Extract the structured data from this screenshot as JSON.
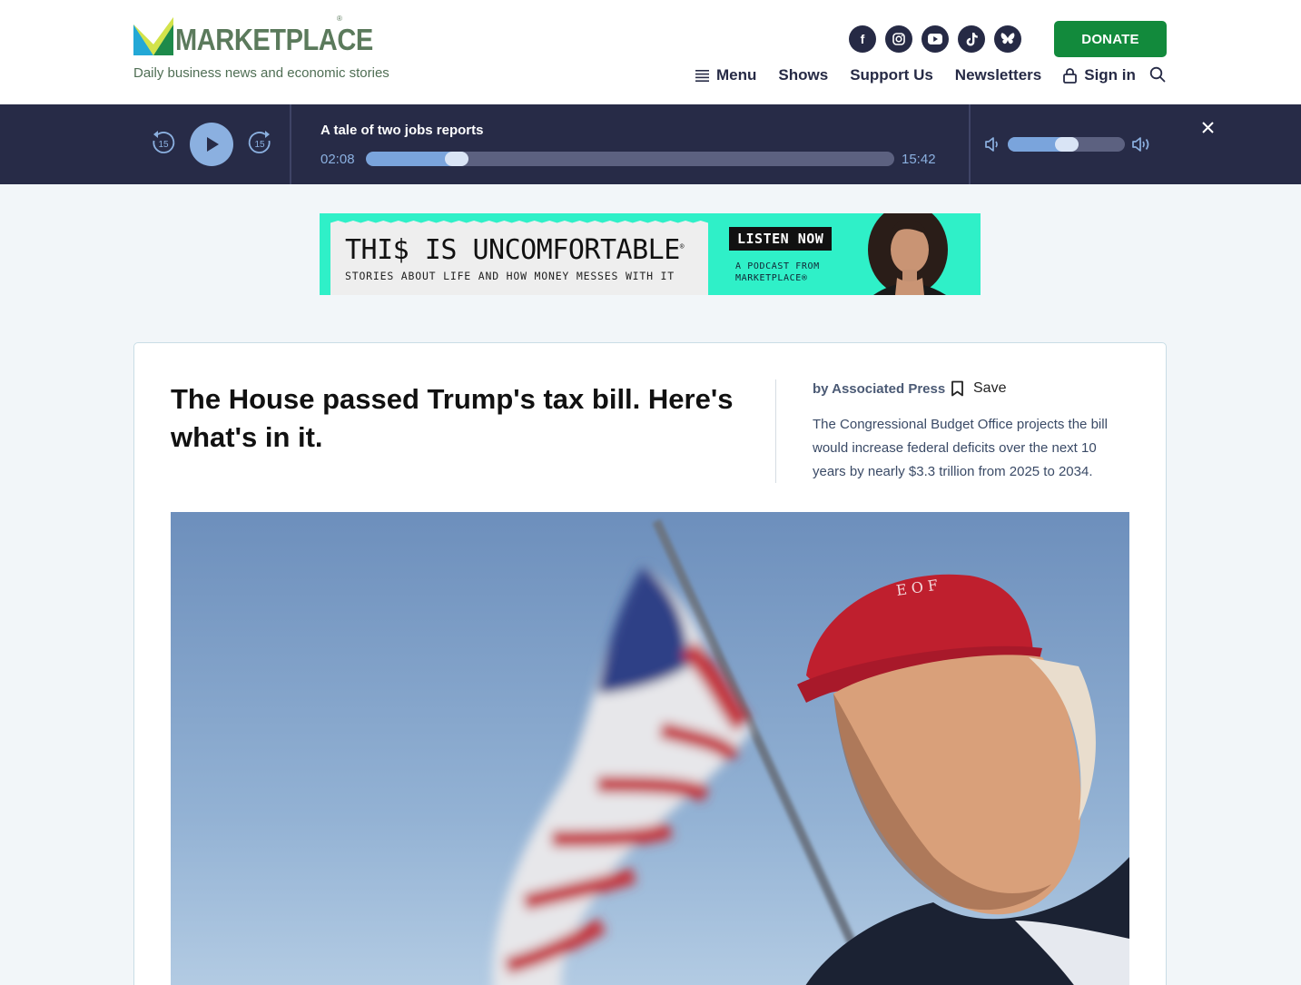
{
  "header": {
    "logo_text": "MARKETPLACE",
    "logo_reg": "®",
    "tagline": "Daily business news and economic stories",
    "socials": [
      {
        "name": "facebook",
        "glyph": "f"
      },
      {
        "name": "instagram",
        "glyph": "◎"
      },
      {
        "name": "youtube",
        "glyph": "▶"
      },
      {
        "name": "tiktok",
        "glyph": "♪"
      },
      {
        "name": "bluesky",
        "glyph": "🦋"
      }
    ],
    "donate_label": "DONATE",
    "nav": {
      "menu": "Menu",
      "shows": "Shows",
      "support": "Support Us",
      "newsletters": "Newsletters",
      "signin": "Sign in"
    },
    "icons": [
      "hamburger-icon",
      "lock-icon",
      "search-icon"
    ]
  },
  "player": {
    "episode_title": "A tale of two jobs reports",
    "elapsed": "02:08",
    "duration": "15:42",
    "progress": 0.15,
    "volume": 0.5,
    "skip_back_seconds": "15",
    "skip_forward_seconds": "15",
    "colors": {
      "bg": "#272b47",
      "accent": "#8bb0e0"
    }
  },
  "ad": {
    "title": "THI$ IS UNCOMFORTABLE",
    "title_reg": "®",
    "subtitle": "STORIES ABOUT LIFE AND HOW MONEY MESSES WITH IT",
    "cta": "LISTEN NOW",
    "podcast_line1": "A PODCAST FROM",
    "podcast_line2": "MARKETPLACE®",
    "bg_color": "#2ff0c8"
  },
  "article": {
    "headline": "The House passed Trump's tax bill. Here's what's in it.",
    "byline": "by Associated Press",
    "save_label": "Save",
    "dek": "The Congressional Budget Office projects the bill would increase federal deficits over the next 10 years by nearly $3.3 trillion from 2025 to 2034."
  }
}
